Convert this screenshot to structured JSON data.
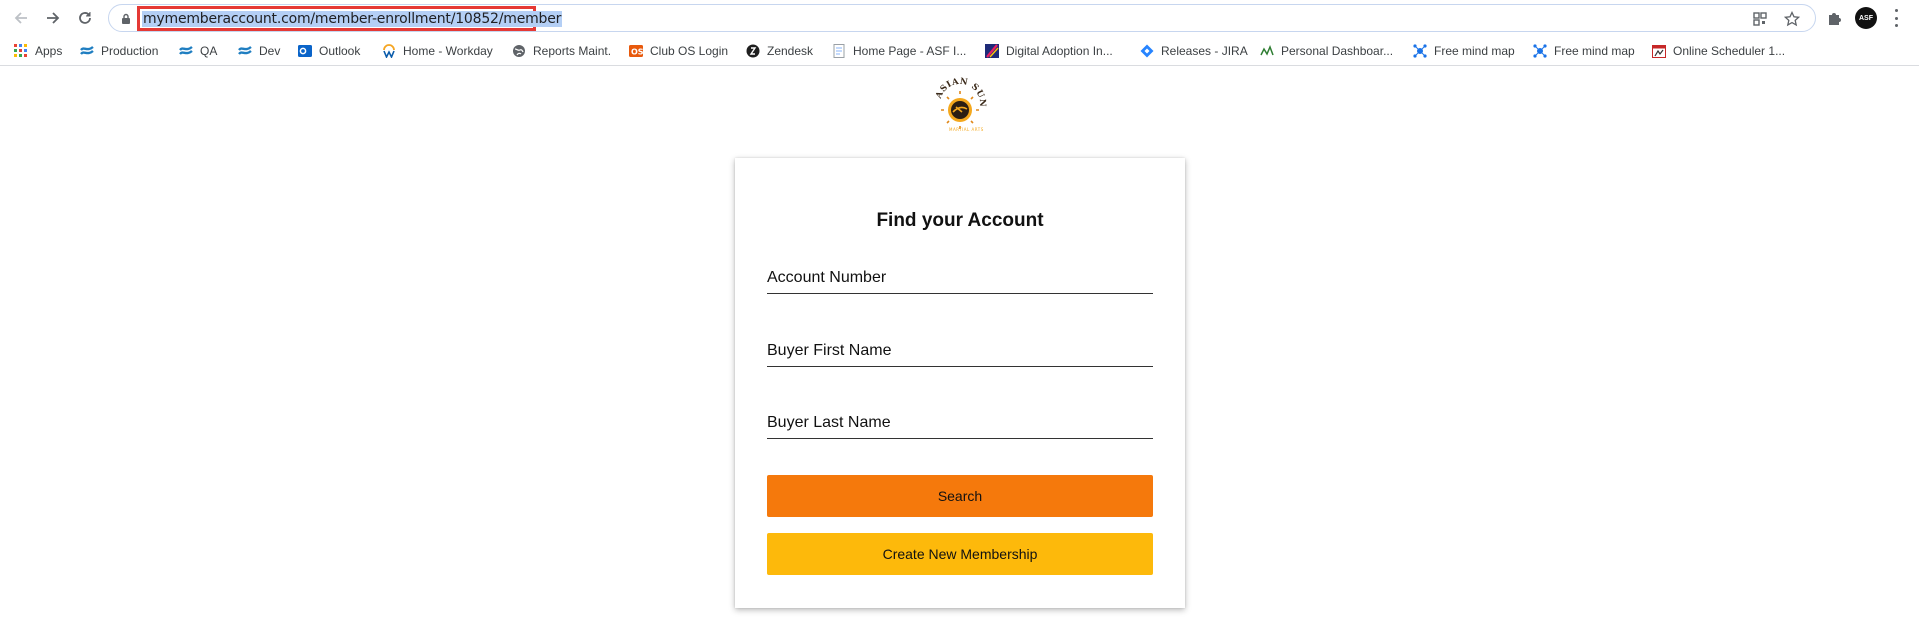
{
  "browser": {
    "url": "mymemberaccount.com/member-enrollment/10852/member",
    "profile_badge": "ASF"
  },
  "bookmarks": [
    {
      "label": "Apps",
      "icon": "apps-grid-icon"
    },
    {
      "label": "Production",
      "icon": "confluence-icon"
    },
    {
      "label": "QA",
      "icon": "confluence-icon"
    },
    {
      "label": "Dev",
      "icon": "confluence-icon"
    },
    {
      "label": "Outlook",
      "icon": "outlook-icon"
    },
    {
      "label": "Home - Workday",
      "icon": "workday-icon"
    },
    {
      "label": "Reports Maint.",
      "icon": "globe-icon"
    },
    {
      "label": "Club OS Login",
      "icon": "office-icon"
    },
    {
      "label": "Zendesk",
      "icon": "zendesk-icon"
    },
    {
      "label": "Home Page - ASF I...",
      "icon": "document-icon"
    },
    {
      "label": "Digital Adoption In...",
      "icon": "digital-adoption-icon"
    },
    {
      "label": "Releases - JIRA",
      "icon": "jira-icon"
    },
    {
      "label": "Personal Dashboar...",
      "icon": "dashboard-icon"
    },
    {
      "label": "Free mind map",
      "icon": "mindmap-icon"
    },
    {
      "label": "Free mind map",
      "icon": "mindmap-icon"
    },
    {
      "label": "Online Scheduler 1...",
      "icon": "scheduler-icon"
    }
  ],
  "form": {
    "title": "Find your Account",
    "account_number_label": "Account Number",
    "first_name_label": "Buyer First Name",
    "last_name_label": "Buyer Last Name",
    "search_label": "Search",
    "create_label": "Create New Membership"
  },
  "colors": {
    "search_button": "#f5790c",
    "create_button": "#fdb90b",
    "url_highlight_border": "#e53935",
    "url_selection": "#b4cff5"
  }
}
